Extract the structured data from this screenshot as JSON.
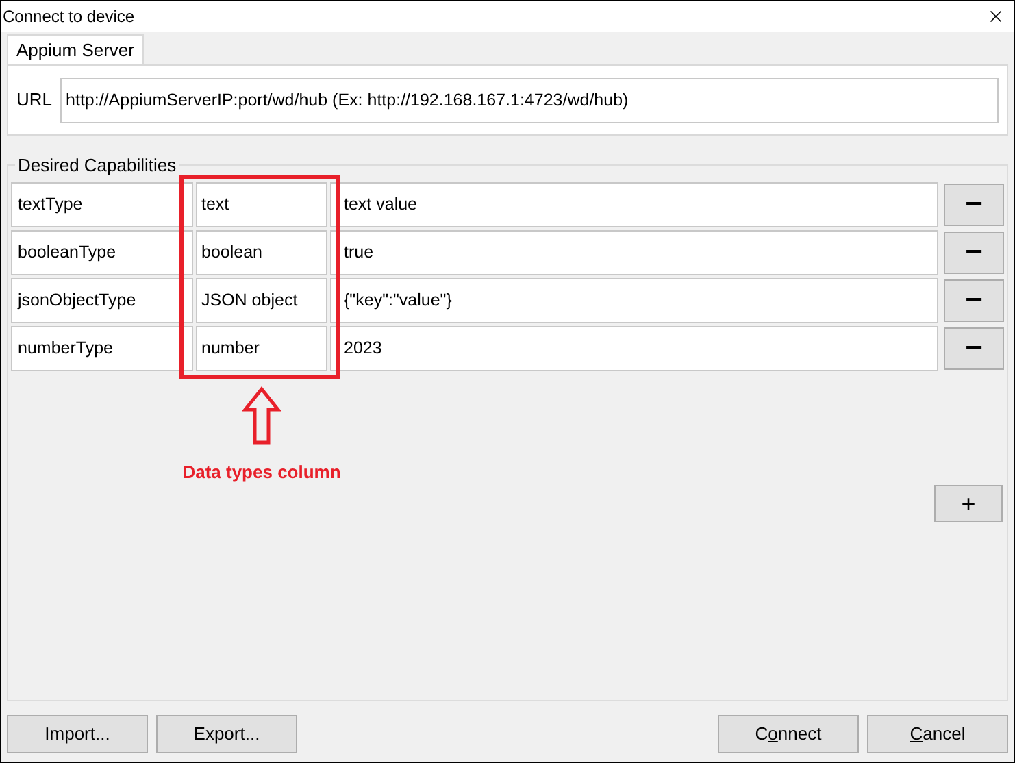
{
  "window": {
    "title": "Connect to device"
  },
  "tabs": [
    {
      "label": "Appium Server",
      "selected": true
    }
  ],
  "url": {
    "label": "URL",
    "value": "http://AppiumServerIP:port/wd/hub (Ex: http://192.168.167.1:4723/wd/hub)"
  },
  "capabilities": {
    "title": "Desired Capabilities",
    "rows": [
      {
        "name": "textType",
        "type": "text",
        "value": "text value",
        "remove": "−"
      },
      {
        "name": "booleanType",
        "type": "boolean",
        "value": "true",
        "remove": "−"
      },
      {
        "name": "jsonObjectType",
        "type": "JSON object",
        "value": "{\"key\":\"value\"}",
        "remove": "−"
      },
      {
        "name": "numberType",
        "type": "number",
        "value": "2023",
        "remove": "−"
      }
    ],
    "add": "+"
  },
  "annotation": {
    "label": "Data types column"
  },
  "left_buttons": [
    {
      "parts": [
        {
          "text": "Import...",
          "underlined": false
        }
      ]
    },
    {
      "parts": [
        {
          "text": "Export...",
          "underlined": false
        }
      ]
    }
  ],
  "right_buttons": [
    {
      "parts": [
        {
          "text": "C",
          "underlined": false
        },
        {
          "text": "o",
          "underlined": true
        },
        {
          "text": "nnect",
          "underlined": false
        }
      ]
    },
    {
      "parts": [
        {
          "text": "C",
          "underlined": true
        },
        {
          "text": "ancel",
          "underlined": false
        }
      ]
    }
  ]
}
